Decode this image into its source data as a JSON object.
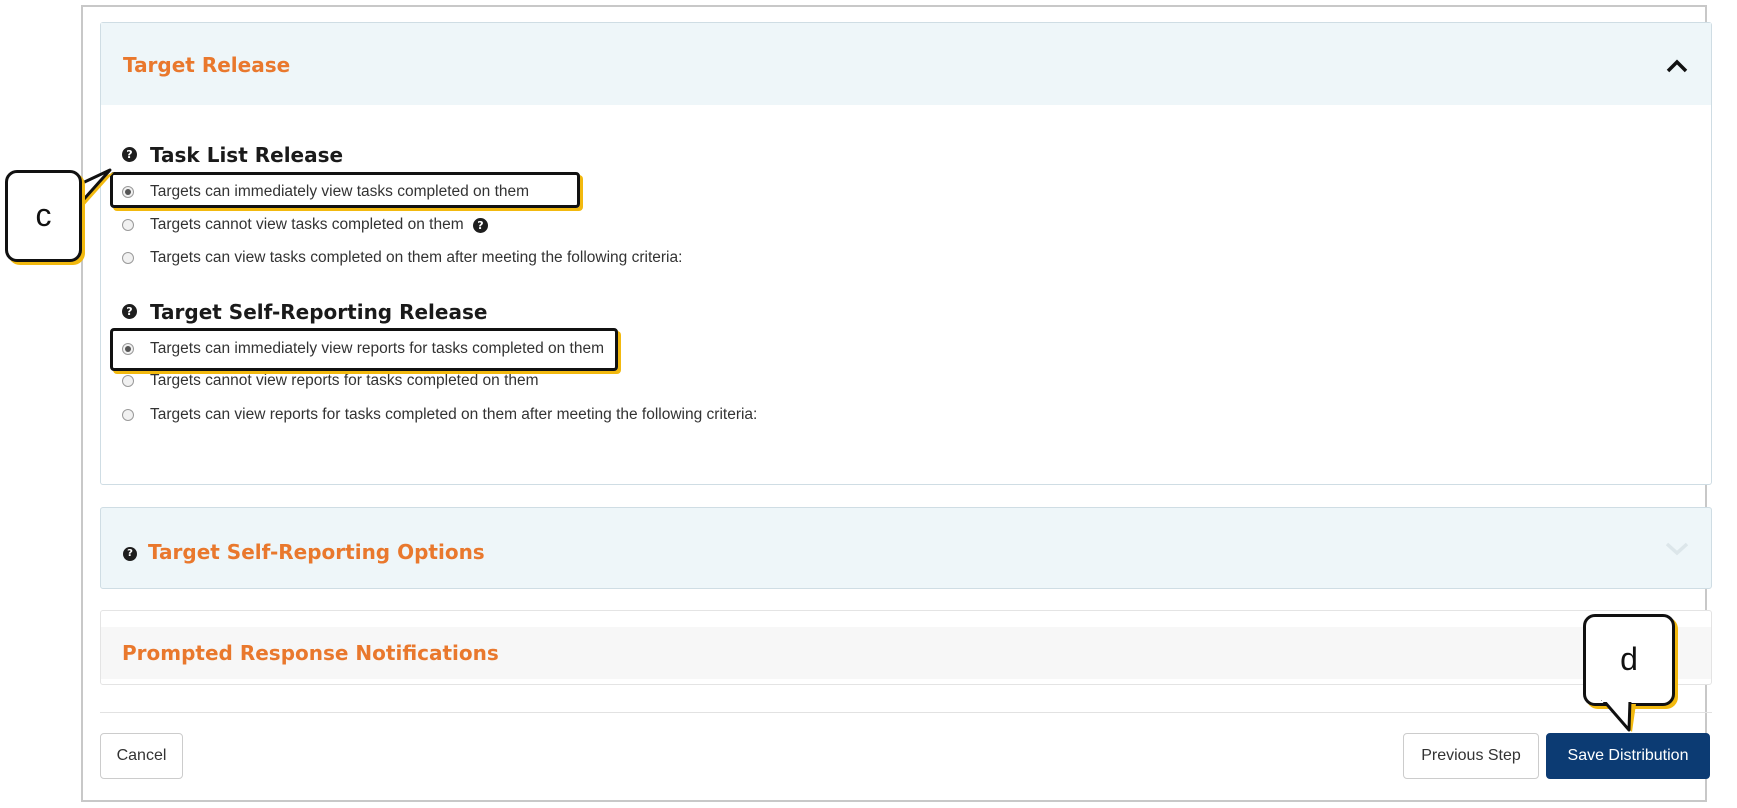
{
  "panels": {
    "target_release": {
      "title": "Target Release",
      "task_list": {
        "heading": "Task List Release",
        "options": [
          "Targets can immediately view tasks completed on them",
          "Targets cannot view tasks completed on them",
          "Targets can view tasks completed on them after meeting the following criteria:"
        ],
        "selected_index": 0
      },
      "self_reporting": {
        "heading": "Target Self-Reporting Release",
        "options": [
          "Targets can immediately view reports for tasks completed on them",
          "Targets cannot view reports for tasks completed on them",
          "Targets can view reports for tasks completed on them after meeting the following criteria:"
        ],
        "selected_index": 0
      }
    },
    "self_reporting_options": {
      "title": "Target Self-Reporting Options"
    },
    "prompted_response": {
      "title": "Prompted Response Notifications"
    }
  },
  "footer": {
    "cancel_label": "Cancel",
    "previous_label": "Previous Step",
    "save_label": "Save Distribution"
  },
  "callouts": {
    "c": "c",
    "d": "d"
  },
  "icons": {
    "help": "question-circle-icon",
    "collapse": "chevron-up-icon",
    "expand": "chevron-down-icon"
  },
  "colors": {
    "title_orange": "#e9782d",
    "header_bg": "#eef6f9",
    "primary_button": "#0c3b73",
    "highlight_yellow": "#f2b90f"
  }
}
